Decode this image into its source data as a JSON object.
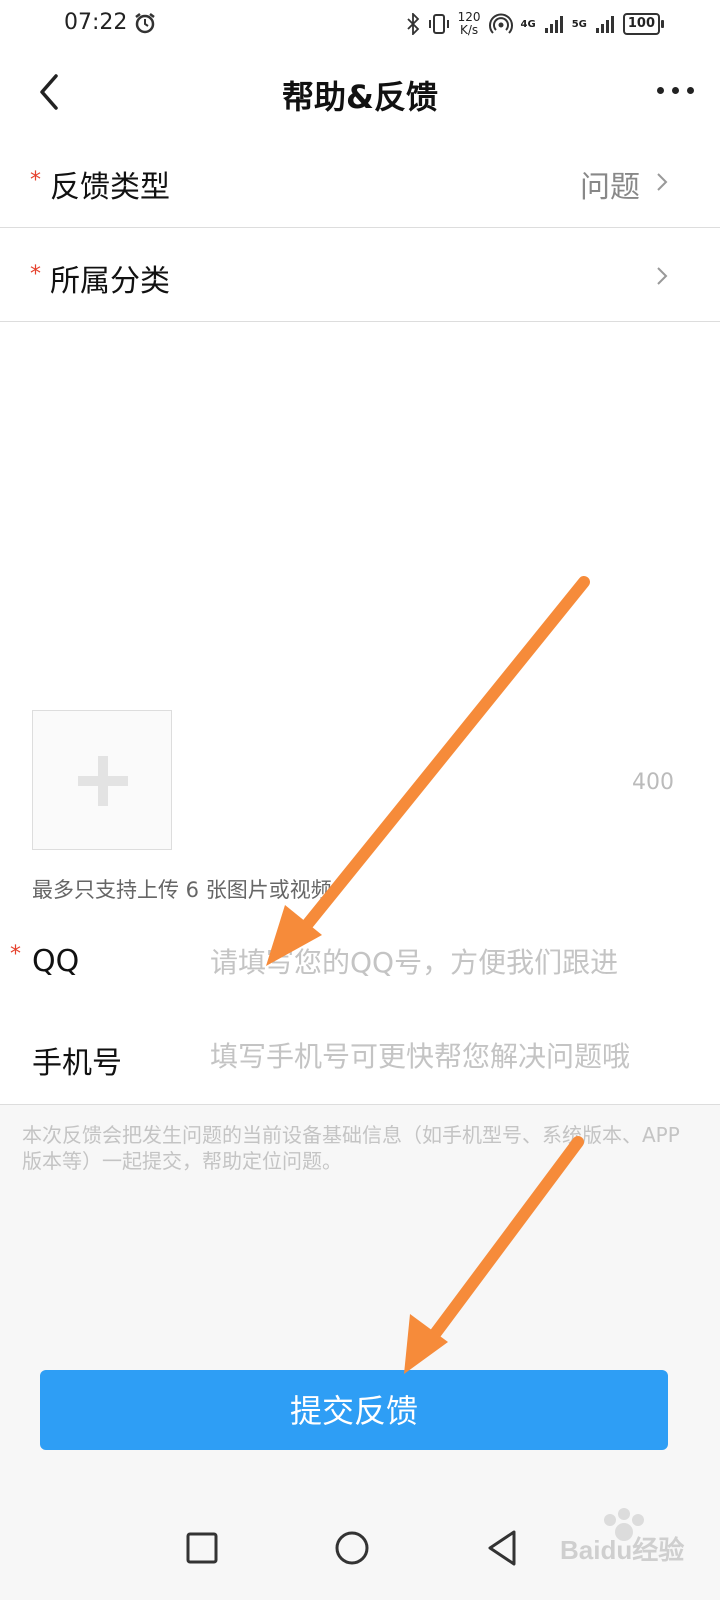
{
  "status": {
    "time": "07:22",
    "net_speed_value": "120",
    "net_speed_unit": "K/s",
    "sig1_label": "4G",
    "sig2_label": "5G",
    "battery": "100"
  },
  "header": {
    "title": "帮助&反馈"
  },
  "form": {
    "feedback_type_label": "反馈类型",
    "feedback_type_value": "问题",
    "category_label": "所属分类",
    "category_value": "",
    "required_mark": "*",
    "char_count": "400",
    "upload_hint": "最多只支持上传 6 张图片或视频",
    "qq_label": "QQ",
    "qq_placeholder": "请填写您的QQ号，方便我们跟进",
    "phone_label": "手机号",
    "phone_placeholder": "填写手机号可更快帮您解决问题哦",
    "notice": "本次反馈会把发生问题的当前设备基础信息（如手机型号、系统版本、APP版本等）一起提交，帮助定位问题。",
    "submit_label": "提交反馈"
  },
  "watermark": {
    "text": "Baidu经验"
  },
  "colors": {
    "accent": "#2e9ef5",
    "required": "#e5412d",
    "annotation_arrow": "#f68b3a"
  }
}
